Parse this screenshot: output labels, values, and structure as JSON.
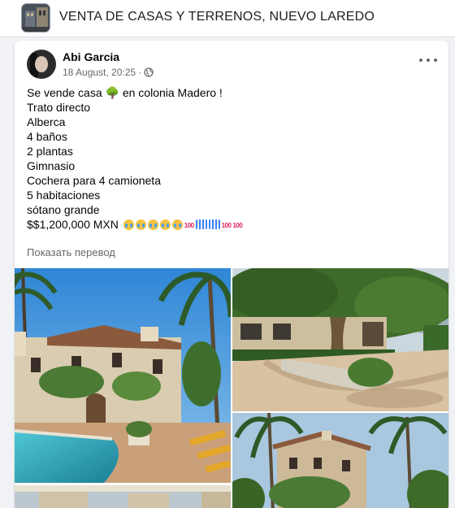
{
  "group": {
    "title": "VENTA DE CASAS Y TERRENOS, NUEVO LAREDO"
  },
  "post": {
    "author": "Abi Garcia",
    "date": "18 August, 20:25",
    "separator": "·",
    "privacy_icon": "globe-icon",
    "more_icon": "more-options-icon",
    "lines": [
      "Se vende casa 🌳 en colonia Madero !",
      "Trato directo",
      "Alberca",
      "4 baños",
      "2 plantas",
      "Gimnasio",
      "Cochera para 4 camioneta",
      "5 habitaciones",
      "sótano grande"
    ],
    "price": "$$1,200,000 MXN",
    "translate_link": "Показать перевод"
  },
  "photos": [
    {
      "name": "photo-villa-pool"
    },
    {
      "name": "photo-driveway-tree"
    },
    {
      "name": "photo-villa-palms"
    },
    {
      "name": "photo-partial"
    }
  ],
  "colors": {
    "page_bg": "#f0f2f5",
    "card_bg": "#ffffff",
    "secondary_text": "#65676b"
  }
}
